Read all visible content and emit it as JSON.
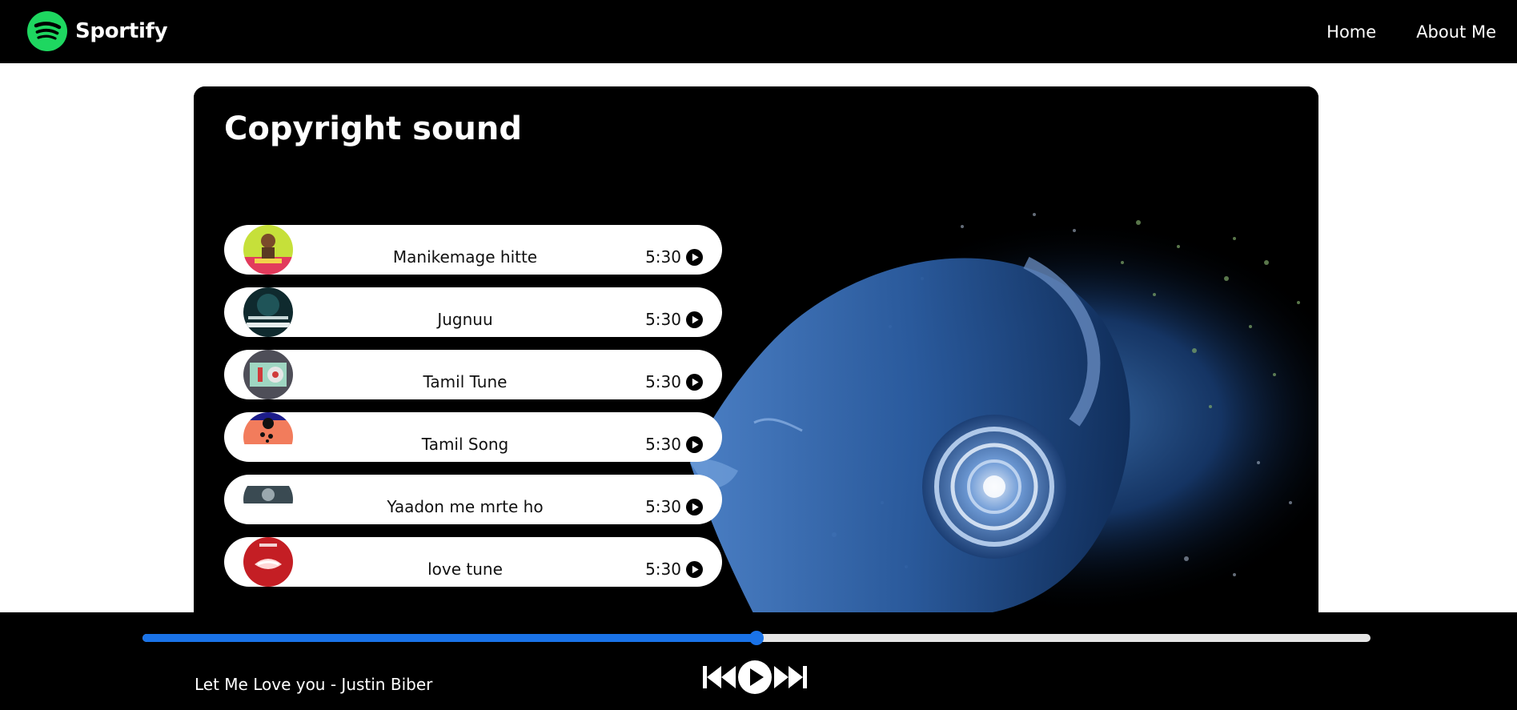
{
  "nav": {
    "brand": "Sportify",
    "links": [
      "Home",
      "About Me"
    ]
  },
  "main": {
    "title": "Copyright sound",
    "songs": [
      {
        "name": "Manikemage hitte",
        "duration": "5:30"
      },
      {
        "name": "Jugnuu",
        "duration": "5:30"
      },
      {
        "name": "Tamil Tune",
        "duration": "5:30"
      },
      {
        "name": "Tamil Song",
        "duration": "5:30"
      },
      {
        "name": "Yaadon me mrte ho",
        "duration": "5:30"
      },
      {
        "name": "love tune",
        "duration": "5:30"
      }
    ]
  },
  "player": {
    "now_playing": "Let Me Love you - Justin Biber",
    "progress": 0.5
  },
  "colors": {
    "brand_green": "#1ed760",
    "progress_blue": "#1a73e8"
  },
  "icons": [
    "spotify-logo-icon",
    "play-circle-icon",
    "previous-track-icon",
    "play-icon",
    "next-track-icon"
  ]
}
